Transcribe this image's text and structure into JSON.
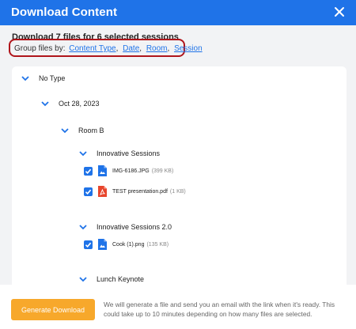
{
  "header": {
    "title": "Download Content"
  },
  "summary": "Download 7 files for 6 selected sessions",
  "group_by": {
    "label": "Group files by:",
    "options": [
      "Content Type",
      "Date",
      "Room",
      "Session"
    ]
  },
  "tree": {
    "type_label": "No Type",
    "date_label": "Oct 28, 2023",
    "room_label": "Room B",
    "sessions": [
      {
        "name": "Innovative Sessions",
        "files": [
          {
            "name": "IMG-6186.JPG",
            "size": "(399 KB)",
            "icon": "image-file-icon"
          },
          {
            "name": "TEST presentation.pdf",
            "size": "(1 KB)",
            "icon": "pdf-file-icon"
          }
        ]
      },
      {
        "name": "Innovative Sessions 2.0",
        "files": [
          {
            "name": "Cook (1).png",
            "size": "(135 KB)",
            "icon": "image-file-icon"
          }
        ]
      },
      {
        "name": "Lunch Keynote",
        "files": []
      }
    ]
  },
  "footer": {
    "button_label": "Generate Download",
    "notice": "We will generate a file and send you an email with the link when it's ready. This could take up to 10 minutes depending on how many files are selected."
  },
  "colors": {
    "primary": "#1f73e8",
    "accent": "#f7a82b",
    "highlight_border": "#b0151b",
    "pdf": "#e8452c"
  }
}
